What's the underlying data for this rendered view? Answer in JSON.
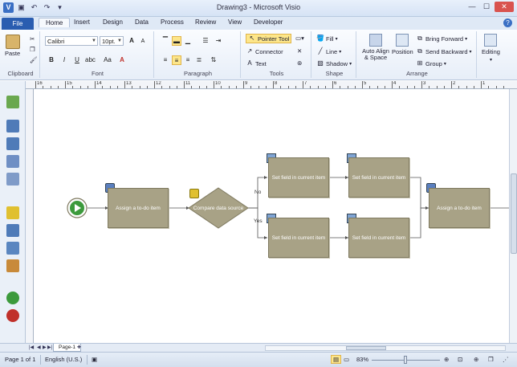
{
  "window": {
    "title": "Drawing3 - Microsoft Visio"
  },
  "tabs": [
    {
      "label": "File"
    },
    {
      "label": "Home"
    },
    {
      "label": "Insert"
    },
    {
      "label": "Design"
    },
    {
      "label": "Data"
    },
    {
      "label": "Process"
    },
    {
      "label": "Review"
    },
    {
      "label": "View"
    },
    {
      "label": "Developer"
    }
  ],
  "ribbon": {
    "clipboard": {
      "label": "Clipboard",
      "paste": "Paste"
    },
    "font": {
      "label": "Font",
      "family": "Calibri",
      "size": "10pt."
    },
    "paragraph": {
      "label": "Paragraph"
    },
    "tools": {
      "label": "Tools",
      "pointer": "Pointer Tool",
      "connector": "Connector",
      "text": "Text"
    },
    "shape": {
      "label": "Shape",
      "fill": "Fill",
      "line": "Line",
      "shadow": "Shadow"
    },
    "arrange": {
      "label": "Arrange",
      "auto_align": "Auto Align & Space",
      "position": "Position",
      "bring_forward": "Bring Forward",
      "send_backward": "Send Backward",
      "group": "Group"
    },
    "editing": {
      "label": "Editing"
    }
  },
  "ruler": {
    "numbers": [
      "16",
      "15",
      "14",
      "13",
      "12",
      "11",
      "10",
      "9",
      "8",
      "7",
      "6",
      "5",
      "4",
      "3",
      "2",
      "1"
    ]
  },
  "diagram": {
    "shapes": [
      {
        "label": "Assign a to-do item"
      },
      {
        "label": "Compare data source"
      },
      {
        "label": "Set field in current item"
      },
      {
        "label": "Set field in current item"
      },
      {
        "label": "Set field in current item"
      },
      {
        "label": "Set field in current item"
      },
      {
        "label": "Assign a to-do item"
      }
    ],
    "branch_no": "No",
    "branch_yes": "Yes"
  },
  "pages": {
    "tab": "Page-1"
  },
  "status": {
    "page": "Page 1 of 1",
    "language": "English (U.S.)",
    "zoom": "83%"
  },
  "colors": {
    "shape_fill": "#a8a286",
    "start_green": "#3c9a3c",
    "stop_red": "#c0302a",
    "accent_blue": "#2a5db0"
  }
}
